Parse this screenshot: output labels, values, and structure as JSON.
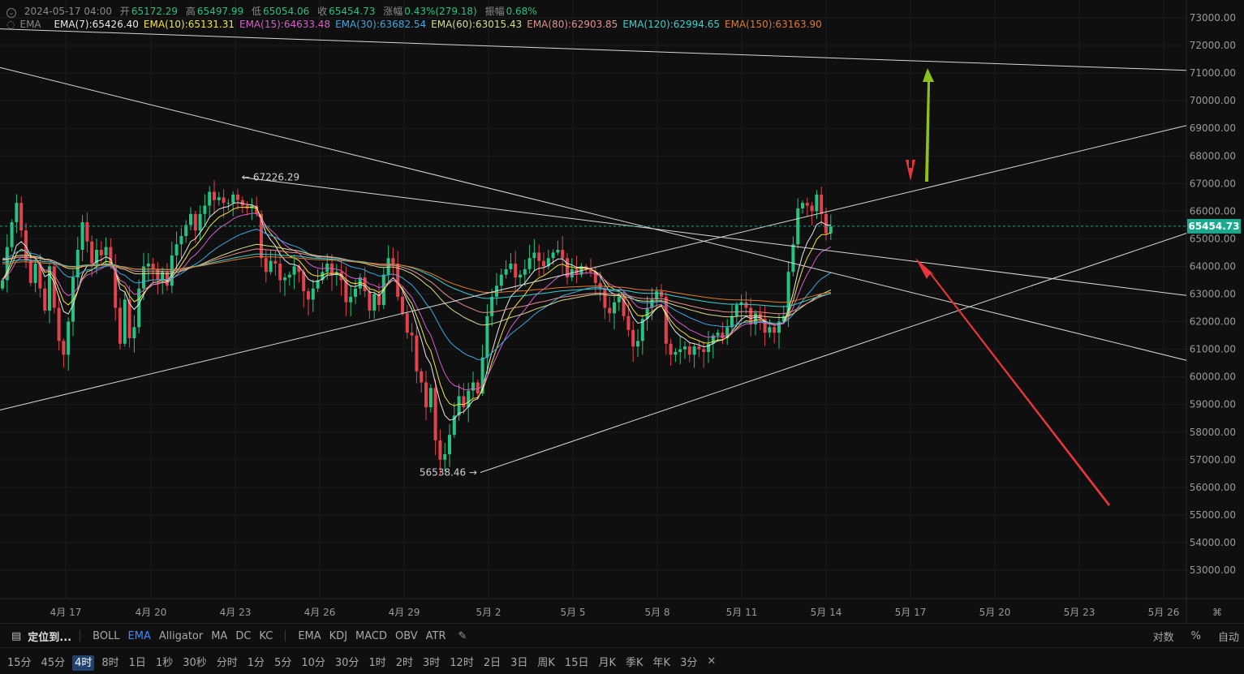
{
  "header": {
    "date": "2024-05-17 04:00",
    "open_label": "开",
    "open": "65172.29",
    "high_label": "高",
    "high": "65497.99",
    "low_label": "低",
    "low": "65054.06",
    "close_label": "收",
    "close": "65454.73",
    "change_label": "涨幅",
    "change": "0.43%(279.18)",
    "amp_label": "振幅",
    "amp": "0.68%",
    "indicator": "EMA",
    "emas": [
      {
        "label": "EMA(7):65426.40",
        "color": "#e8e8e8"
      },
      {
        "label": "EMA(10):65131.31",
        "color": "#f2e43a"
      },
      {
        "label": "EMA(15):64633.48",
        "color": "#d65ec9"
      },
      {
        "label": "EMA(30):63682.54",
        "color": "#3aa9e0"
      },
      {
        "label": "EMA(60):63015.43",
        "color": "#d7dc8e"
      },
      {
        "label": "EMA(80):62903.85",
        "color": "#e48f8f"
      },
      {
        "label": "EMA(120):62994.65",
        "color": "#39d0d0"
      },
      {
        "label": "EMA(150):63163.90",
        "color": "#e07a2c"
      }
    ]
  },
  "chart_data": {
    "type": "candlestick",
    "ylim": [
      52200,
      73400
    ],
    "y_ticks": [
      "73000.00",
      "72000.00",
      "71000.00",
      "70000.00",
      "69000.00",
      "68000.00",
      "67000.00",
      "66000.00",
      "65000.00",
      "64000.00",
      "63000.00",
      "62000.00",
      "61000.00",
      "60000.00",
      "59000.00",
      "58000.00",
      "57000.00",
      "56000.00",
      "55000.00",
      "54000.00",
      "53000.00"
    ],
    "x_ticks": [
      "4月 17",
      "4月 20",
      "4月 23",
      "4月 26",
      "4月 29",
      "5月 2",
      "5月 5",
      "5月 8",
      "5月 11",
      "5月 14",
      "5月 17",
      "5月 20",
      "5月 23",
      "5月 26"
    ],
    "last_price": "65454.73",
    "high_annotation": "67226.29",
    "low_annotation": "56538.46",
    "close_series": [
      63500,
      64700,
      65600,
      66300,
      65300,
      64200,
      63400,
      64100,
      63200,
      62400,
      64000,
      62500,
      61300,
      60800,
      62000,
      63600,
      64600,
      65600,
      64900,
      64100,
      64600,
      64400,
      64700,
      64000,
      62500,
      61200,
      62800,
      61400,
      61800,
      63200,
      64000,
      64100,
      63900,
      63500,
      63800,
      63300,
      64400,
      64800,
      65100,
      65500,
      65900,
      65300,
      65900,
      66200,
      66700,
      66400,
      66500,
      66300,
      66300,
      66600,
      66400,
      66200,
      66100,
      66200,
      65900,
      64300,
      63800,
      64200,
      64100,
      63500,
      63600,
      63700,
      64000,
      63800,
      63100,
      62800,
      63200,
      63500,
      63800,
      64100,
      63700,
      63800,
      63500,
      62700,
      62900,
      63200,
      63600,
      63100,
      62400,
      63000,
      62600,
      63700,
      64300,
      64100,
      62900,
      62300,
      61600,
      61500,
      60200,
      59800,
      58900,
      59600,
      57700,
      57000,
      57200,
      57900,
      58600,
      59300,
      58900,
      59500,
      59800,
      59400,
      60700,
      62200,
      62900,
      63300,
      63700,
      63900,
      64100,
      63600,
      63700,
      63900,
      64300,
      64500,
      64200,
      64000,
      64300,
      64500,
      64600,
      64300,
      63600,
      63900,
      63700,
      64000,
      63900,
      63800,
      63400,
      63200,
      62500,
      62300,
      62700,
      62900,
      62200,
      61700,
      61100,
      61300,
      62100,
      62500,
      62800,
      63100,
      62900,
      61200,
      60800,
      60900,
      61000,
      61100,
      60800,
      61100,
      61000,
      60900,
      61200,
      61500,
      61600,
      61400,
      61800,
      62200,
      62600,
      62700,
      62500,
      61900,
      62300,
      62100,
      61600,
      61800,
      61600,
      62000,
      62200,
      63800,
      64800,
      66100,
      66300,
      66200,
      66000,
      66600,
      65900,
      65200,
      65450
    ],
    "ema_series_names": [
      "EMA(7)",
      "EMA(10)",
      "EMA(15)",
      "EMA(30)",
      "EMA(60)",
      "EMA(80)",
      "EMA(120)",
      "EMA(150)"
    ],
    "ema_series_colors": [
      "#e8e8e8",
      "#f2e43a",
      "#d65ec9",
      "#3aa9e0",
      "#d7dc8e",
      "#e48f8f",
      "#39d0d0",
      "#e07a2c"
    ],
    "ema_periods": [
      7,
      10,
      15,
      30,
      60,
      80,
      120,
      150
    ]
  },
  "toolbar1": {
    "locate_label": "定位到...",
    "indicators": [
      "BOLL",
      "EMA",
      "Alligator",
      "MA",
      "DC",
      "KC"
    ],
    "sub_indicators": [
      "EMA",
      "KDJ",
      "MACD",
      "OBV",
      "ATR"
    ],
    "right": [
      "对数",
      "%",
      "自动"
    ]
  },
  "toolbar2": {
    "timeframes": [
      "15分",
      "45分",
      "4时",
      "8时",
      "1日",
      "1秒",
      "30秒",
      "分时",
      "1分",
      "5分",
      "10分",
      "30分",
      "1时",
      "2时",
      "3时",
      "12时",
      "2日",
      "3日",
      "周K",
      "15日",
      "月K",
      "季K",
      "年K",
      "3分"
    ],
    "active": "4时"
  }
}
